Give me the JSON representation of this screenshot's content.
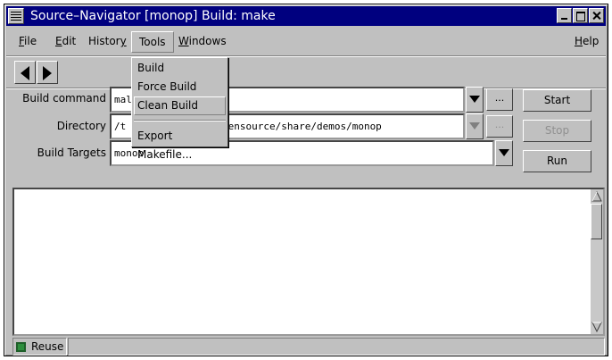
{
  "window": {
    "title": "Source–Navigator [monop] Build: make"
  },
  "menubar": {
    "items": [
      {
        "label": "File",
        "u": "F",
        "rest": "ile"
      },
      {
        "label": "Edit",
        "u": "E",
        "rest": "dit"
      },
      {
        "label": "History",
        "pre": "Histor",
        "u": "y"
      },
      {
        "label": "Tools"
      },
      {
        "label": "Windows",
        "u": "W",
        "rest": "indows"
      },
      {
        "label": "Help",
        "u": "H",
        "rest": "elp"
      }
    ]
  },
  "tools_menu": {
    "items": [
      "Build",
      "Force Build",
      "Clean Build",
      "Export Makefile..."
    ],
    "hovered": "Clean Build"
  },
  "form": {
    "build_command_label": "Build command",
    "build_command_visible": "mal",
    "directory_label": "Directory",
    "directory_visible_left": "/t",
    "directory_visible_right": "pensource/share/demos/monop",
    "build_targets_label": "Build Targets",
    "build_targets_value": "monop",
    "dots_label": "..."
  },
  "buttons": {
    "start": "Start",
    "stop": "Stop",
    "run": "Run"
  },
  "status": {
    "reuse_label": "Reuse",
    "reuse_indicator_color": "#2f8f3f"
  },
  "colors": {
    "titlebar": "#00007f",
    "window_bg": "#c0c0c0"
  }
}
